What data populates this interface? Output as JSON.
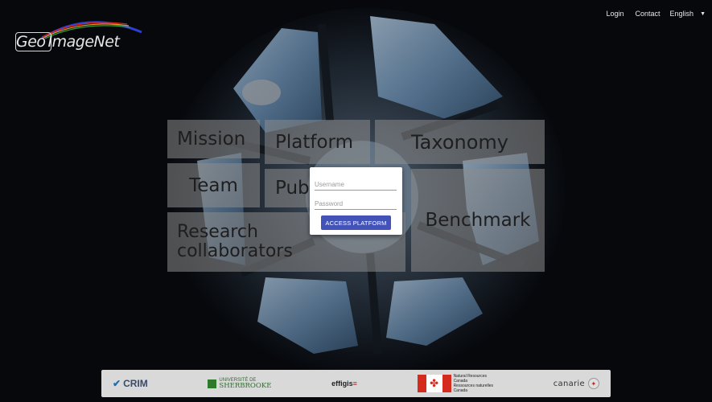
{
  "brand": {
    "logo_text": "GeoImageNet",
    "logo_part1": "Geo",
    "logo_part2": "ImageNet"
  },
  "nav": {
    "login": "Login",
    "contact": "Contact",
    "language": "English"
  },
  "tiles": {
    "mission": "Mission",
    "platform": "Platform",
    "taxonomy": "Taxonomy",
    "team": "Team",
    "publications": "Publications",
    "benchmark": "Benchmark",
    "research_line1": "Research",
    "research_line2": "collaborators"
  },
  "login_form": {
    "username_placeholder": "Username",
    "password_placeholder": "Password",
    "submit_label": "ACCESS PLATFORM"
  },
  "partners": {
    "crim": "CRIM",
    "sherbrooke_line1": "UNIVERSITÉ DE",
    "sherbrooke_line2": "SHERBROOKE",
    "effigis": "effigis",
    "nrc_line1": "Natural Resources",
    "nrc_line2": "Canada",
    "nrc_line3": "Ressources naturelles",
    "nrc_line4": "Canada",
    "canarie": "canarie"
  },
  "colors": {
    "accent_button": "#4353b8",
    "tile_fill": "rgba(140,140,140,0.55)",
    "background": "#06080c"
  }
}
